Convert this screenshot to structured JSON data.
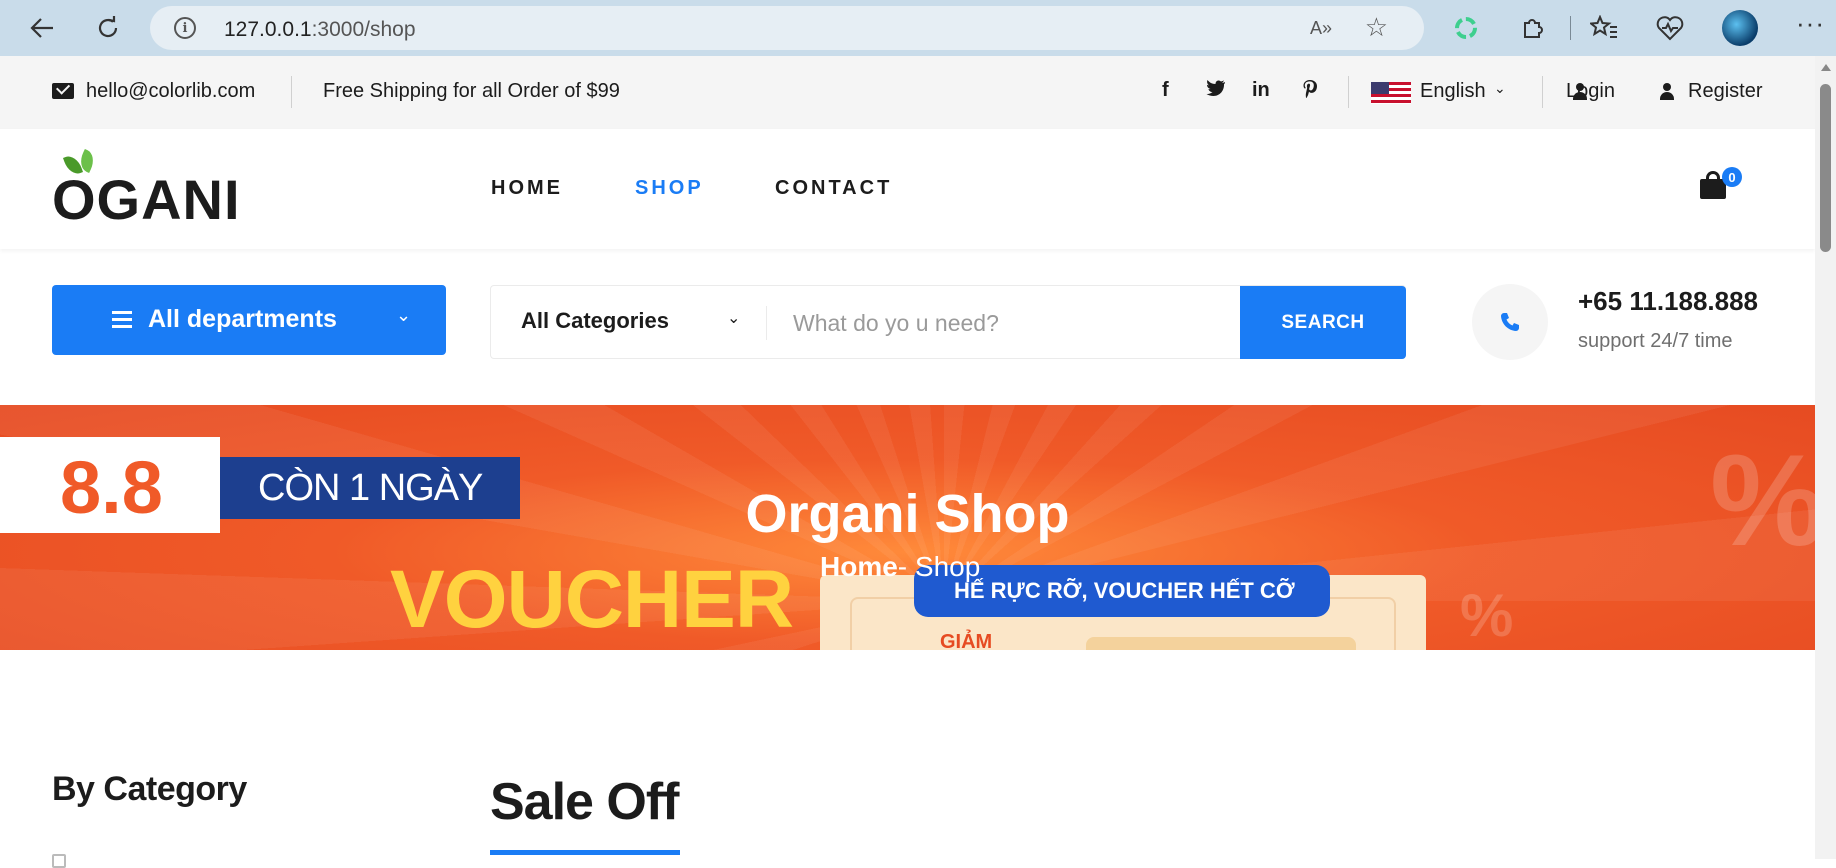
{
  "browser": {
    "url_host": "127.0.0.1",
    "url_path": ":3000/shop",
    "read_aloud": "A»"
  },
  "topbar": {
    "email": "hello@colorlib.com",
    "shipping": "Free Shipping for all Order of $99",
    "social": [
      "f",
      "t",
      "in",
      "p"
    ],
    "language": "English",
    "login": "Login",
    "register": "Register"
  },
  "header": {
    "logo": "OGANI",
    "nav": [
      {
        "label": "HOME"
      },
      {
        "label": "SHOP"
      },
      {
        "label": "CONTACT"
      }
    ],
    "cart_count": "0",
    "accent_color": "#1a7cf5"
  },
  "hero": {
    "departments_label": "All departments",
    "category_select": "All Categories",
    "search_placeholder": "What do yo u need?",
    "search_button": "SEARCH",
    "phone": "+65 11.188.888",
    "support": "support 24/7 time"
  },
  "banner": {
    "title": "Organi Shop",
    "breadcrumb_home": "Home",
    "breadcrumb_sep": "-",
    "breadcrumb_current": "Shop",
    "promo_88": "8.8",
    "promo_con": "CÒN 1 NGÀY",
    "promo_voucher": "VOUCHER",
    "promo_ribbon": "HẾ RỰC RỠ, VOUCHER HẾT CỠ",
    "promo_giam": "GIẢM",
    "promo_pct": "%"
  },
  "content": {
    "by_category": "By Category",
    "sale_off": "Sale Off"
  }
}
